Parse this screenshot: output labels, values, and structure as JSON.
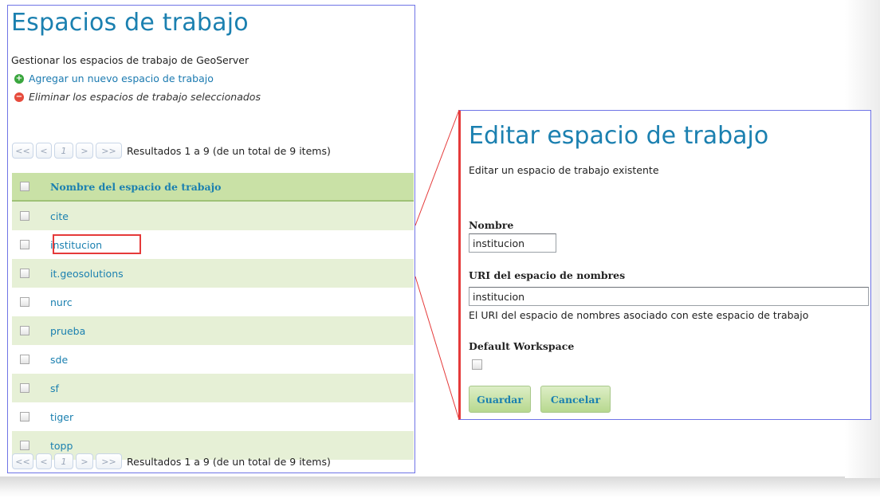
{
  "workspaces_page": {
    "title": "Espacios de trabajo",
    "description": "Gestionar los espacios de trabajo de GeoServer",
    "add_link": "Agregar un nuevo espacio de trabajo",
    "remove_link": "Eliminar los espacios de trabajo seleccionados",
    "pager": {
      "first": "<<",
      "prev": "<",
      "page": "1",
      "next": ">",
      "last": ">>",
      "results": "Resultados 1 a 9 (de un total de 9 items)"
    },
    "table": {
      "column_header": "Nombre del espacio de trabajo",
      "rows": [
        "cite",
        "institucion",
        "it.geosolutions",
        "nurc",
        "prueba",
        "sde",
        "sf",
        "tiger",
        "topp"
      ],
      "highlighted_row": "institucion"
    }
  },
  "edit_workspace": {
    "title": "Editar espacio de trabajo",
    "description": "Editar un espacio de trabajo existente",
    "name_label": "Nombre",
    "name_value": "institucion",
    "uri_label": "URI del espacio de nombres",
    "uri_value": "institucion",
    "uri_help": "El URI del espacio de nombres asociado con este espacio de trabajo",
    "default_label": "Default Workspace",
    "default_checked": false,
    "save_button": "Guardar",
    "cancel_button": "Cancelar"
  },
  "colors": {
    "title_blue": "#1b80b0",
    "panel_border": "#6f74e6",
    "highlight_red": "#e53a3a",
    "row_green": "#e6f0d6",
    "header_green": "#c9e1a6"
  }
}
